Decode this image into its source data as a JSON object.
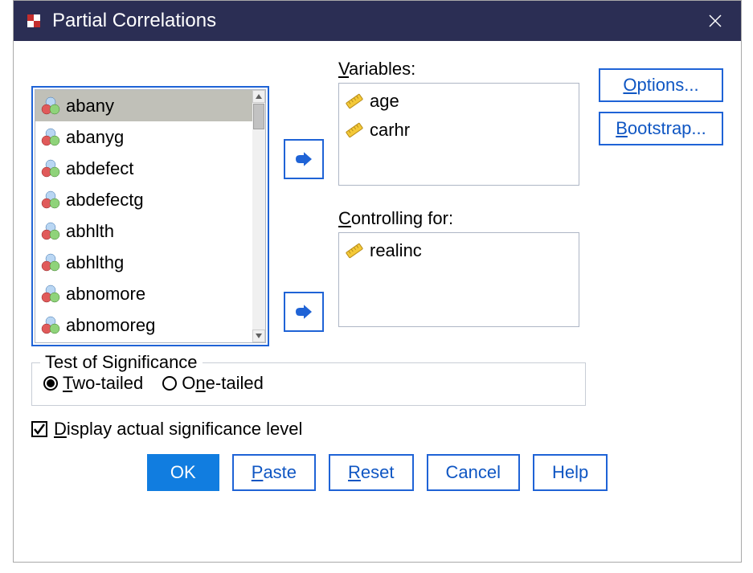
{
  "title": "Partial Correlations",
  "source_items": [
    "abany",
    "abanyg",
    "abdefect",
    "abdefectg",
    "abhlth",
    "abhlthg",
    "abnomore",
    "abnomoreg"
  ],
  "source_selected_index": 0,
  "variables_label": "Variables:",
  "variables": [
    "age",
    "carhr"
  ],
  "controlling_label": "Controlling for:",
  "controlling": [
    "realinc"
  ],
  "side_buttons": {
    "options": "Options...",
    "bootstrap": "Bootstrap..."
  },
  "significance": {
    "legend": "Test of Significance",
    "two_tailed": "Two-tailed",
    "one_tailed": "One-tailed",
    "selected": "two_tailed"
  },
  "display_sig_label": "Display actual significance level",
  "display_sig_checked": true,
  "buttons": {
    "ok": "OK",
    "paste": "Paste",
    "reset": "Reset",
    "cancel": "Cancel",
    "help": "Help"
  }
}
